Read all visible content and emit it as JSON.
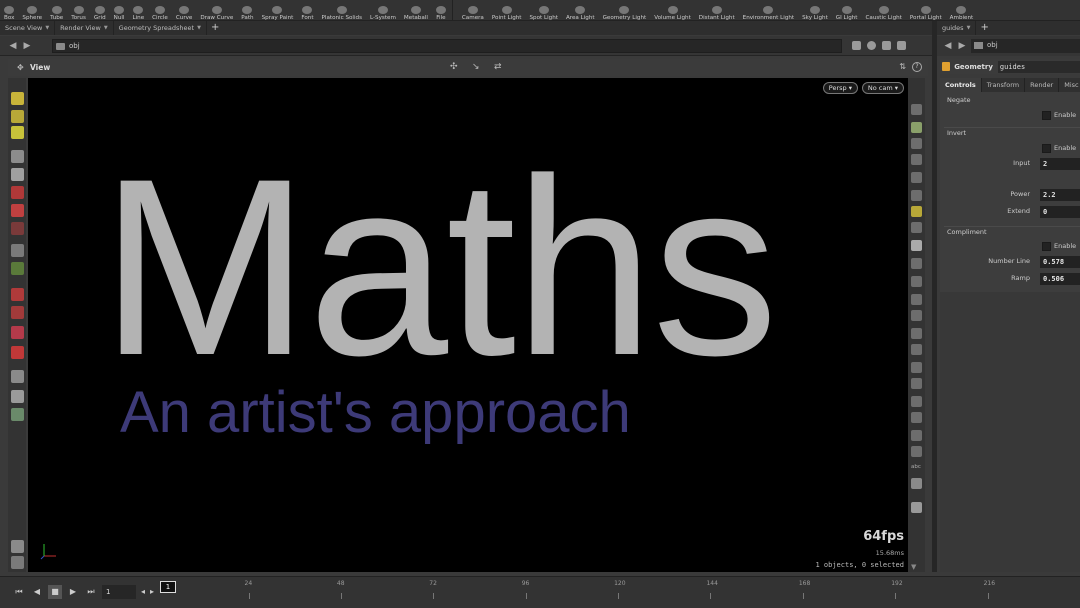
{
  "shelf": {
    "create_tools": [
      "Box",
      "Sphere",
      "Tube",
      "Torus",
      "Grid",
      "Null",
      "Line",
      "Circle",
      "Curve",
      "Draw Curve",
      "Path",
      "Spray Paint",
      "Font",
      "Platonic Solids",
      "L-System",
      "Metaball",
      "File"
    ],
    "light_tools": [
      "Camera",
      "Point Light",
      "Spot Light",
      "Area Light",
      "Geometry Light",
      "Volume Light",
      "Distant Light",
      "Environment Light",
      "Sky Light",
      "GI Light",
      "Caustic Light",
      "Portal Light",
      "Ambient"
    ]
  },
  "pane_tabs": [
    "Scene View",
    "Render View",
    "Geometry Spreadsheet"
  ],
  "path": {
    "value": "obj"
  },
  "view": {
    "title": "View",
    "persp_label": "Persp",
    "cam_label": "No cam",
    "main_text": "Maths",
    "sub_text": "An artist's approach",
    "fps": "64fps",
    "ms": "15.68ms",
    "selection_info": "1 objects, 0 selected"
  },
  "right_pane": {
    "tab": "guides",
    "path": "obj",
    "node_type": "Geometry",
    "node_name": "guides",
    "param_tabs": [
      "Controls",
      "Transform",
      "Render",
      "Misc"
    ],
    "sections": {
      "negate": "Negate",
      "invert": "Invert",
      "compliment": "Compliment"
    },
    "enable_label": "Enable",
    "params": {
      "input_label": "Input",
      "input_value": "2",
      "power_label": "Power",
      "power_value": "2.2",
      "extend_label": "Extend",
      "extend_value": "0",
      "number_line_label": "Number Line",
      "number_line_value": "0.578",
      "ramp_label": "Ramp",
      "ramp_value": "0.506"
    }
  },
  "timeline": {
    "current_frame": "1",
    "frame_field": "1",
    "ticks": [
      "24",
      "48",
      "72",
      "96",
      "120",
      "144",
      "168",
      "192",
      "216"
    ]
  },
  "colors": {
    "maths_text": "#b3b3b3",
    "subtitle_text": "#3d3a78",
    "viewport_bg": "#000000"
  }
}
